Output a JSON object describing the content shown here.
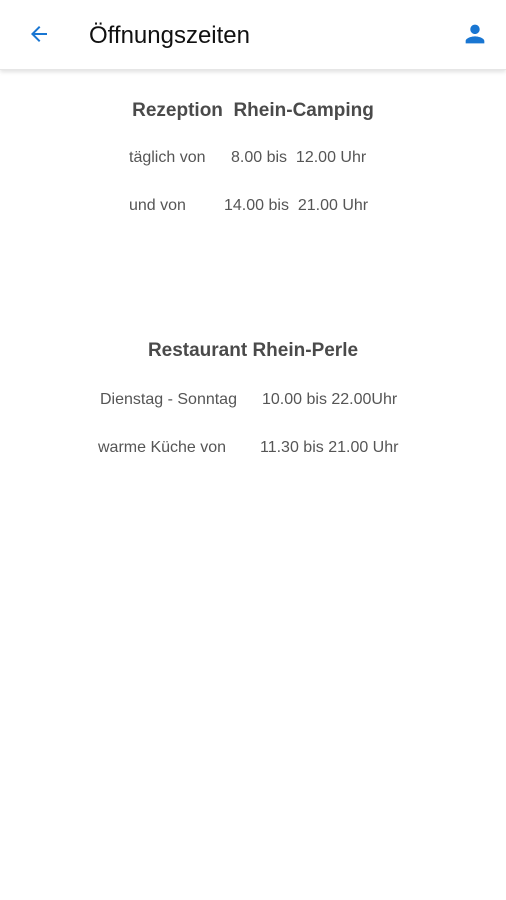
{
  "header": {
    "title": "Öffnungszeiten",
    "accent_color": "#1976d2",
    "back_icon": "arrow-left-icon",
    "profile_icon": "person-icon"
  },
  "reception": {
    "heading": "Rezeption  Rhein-Camping",
    "rows": [
      {
        "label": "täglich von",
        "time": "8.00 bis  12.00 Uhr"
      },
      {
        "label": "und von",
        "time": "14.00 bis  21.00 Uhr"
      }
    ]
  },
  "restaurant": {
    "heading": "Restaurant Rhein-Perle",
    "rows": [
      {
        "label": "Dienstag - Sonntag",
        "time": "10.00 bis 22.00Uhr"
      },
      {
        "label": "warme Küche von",
        "time": "11.30 bis 21.00 Uhr"
      }
    ]
  }
}
